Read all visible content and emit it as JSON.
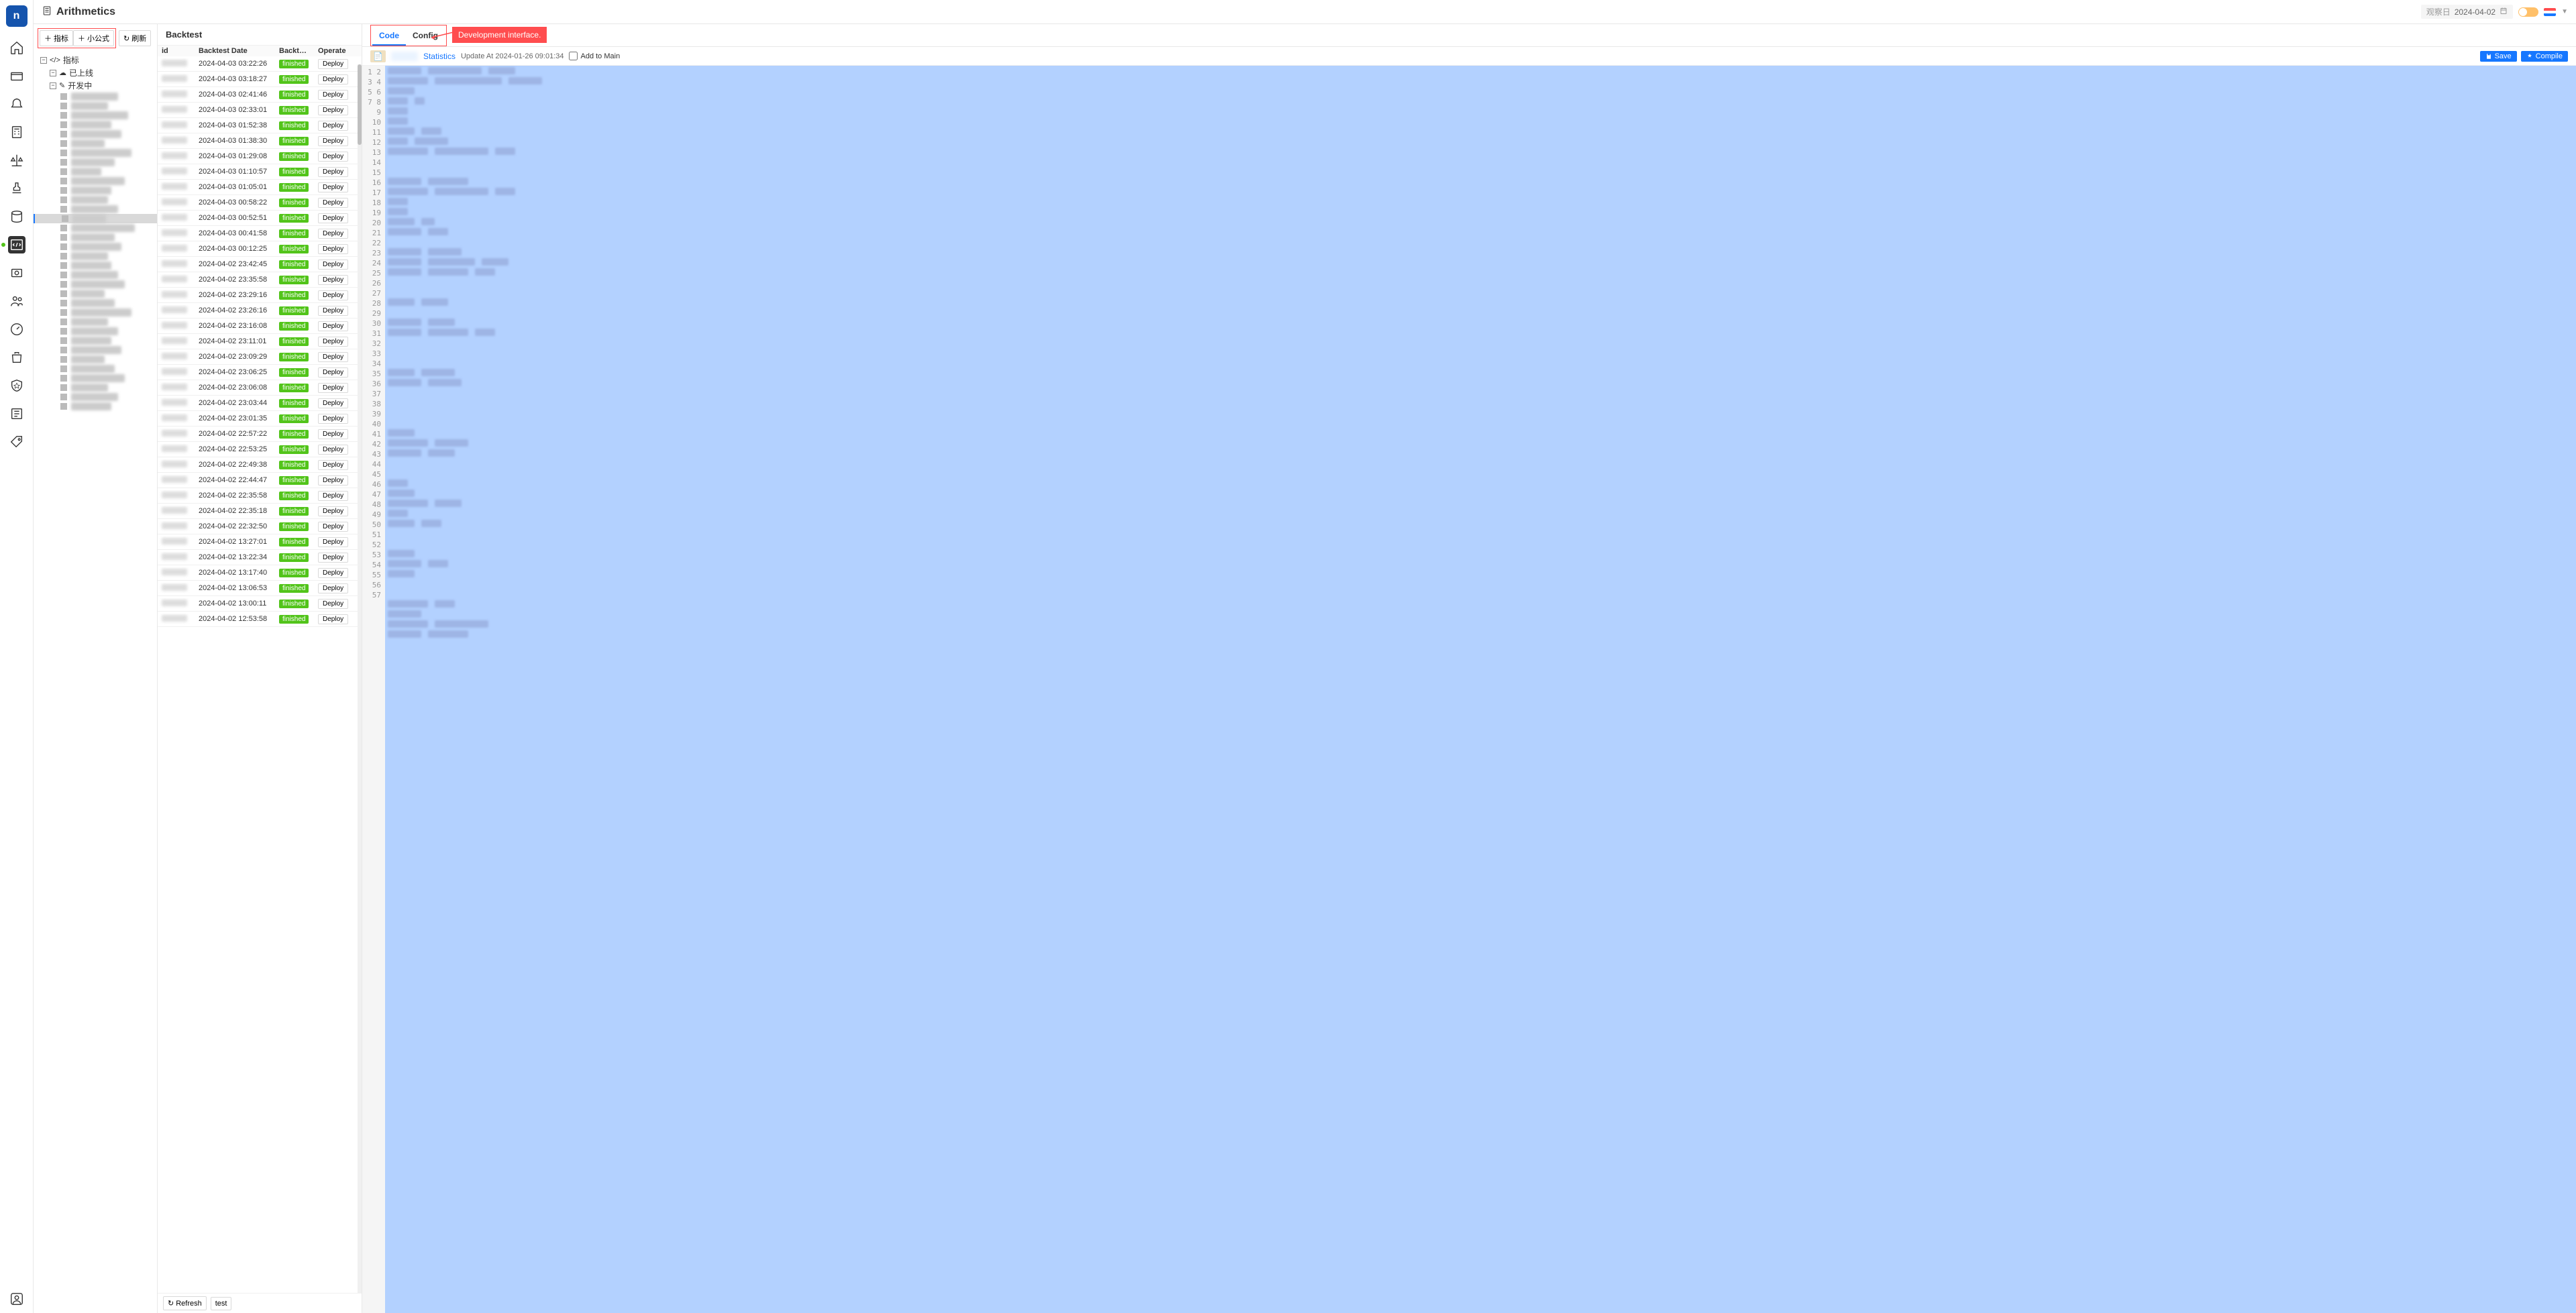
{
  "title": "Arithmetics",
  "header": {
    "obs_label": "观察日",
    "obs_date": "2024-04-02"
  },
  "toolbar": {
    "indicator": "指标",
    "formula": "小公式",
    "refresh": "刷新"
  },
  "tree": {
    "root": "指标",
    "online": "已上线",
    "developing": "开发中"
  },
  "backtest": {
    "title": "Backtest",
    "cols": {
      "id": "id",
      "date": "Backtest Date",
      "status": "Backtest ...",
      "operate": "Operate"
    },
    "status_label": "finished",
    "deploy_label": "Deploy",
    "refresh": "Refresh",
    "test": "test",
    "rows": [
      {
        "date": "2024-04-03 03:22:26"
      },
      {
        "date": "2024-04-03 03:18:27"
      },
      {
        "date": "2024-04-03 02:41:46"
      },
      {
        "date": "2024-04-03 02:33:01"
      },
      {
        "date": "2024-04-03 01:52:38"
      },
      {
        "date": "2024-04-03 01:38:30"
      },
      {
        "date": "2024-04-03 01:29:08"
      },
      {
        "date": "2024-04-03 01:10:57"
      },
      {
        "date": "2024-04-03 01:05:01"
      },
      {
        "date": "2024-04-03 00:58:22"
      },
      {
        "date": "2024-04-03 00:52:51"
      },
      {
        "date": "2024-04-03 00:41:58"
      },
      {
        "date": "2024-04-03 00:12:25"
      },
      {
        "date": "2024-04-02 23:42:45"
      },
      {
        "date": "2024-04-02 23:35:58"
      },
      {
        "date": "2024-04-02 23:29:16"
      },
      {
        "date": "2024-04-02 23:26:16"
      },
      {
        "date": "2024-04-02 23:16:08"
      },
      {
        "date": "2024-04-02 23:11:01"
      },
      {
        "date": "2024-04-02 23:09:29"
      },
      {
        "date": "2024-04-02 23:06:25"
      },
      {
        "date": "2024-04-02 23:06:08"
      },
      {
        "date": "2024-04-02 23:03:44"
      },
      {
        "date": "2024-04-02 23:01:35"
      },
      {
        "date": "2024-04-02 22:57:22"
      },
      {
        "date": "2024-04-02 22:53:25"
      },
      {
        "date": "2024-04-02 22:49:38"
      },
      {
        "date": "2024-04-02 22:44:47"
      },
      {
        "date": "2024-04-02 22:35:58"
      },
      {
        "date": "2024-04-02 22:35:18"
      },
      {
        "date": "2024-04-02 22:32:50"
      },
      {
        "date": "2024-04-02 13:27:01"
      },
      {
        "date": "2024-04-02 13:22:34"
      },
      {
        "date": "2024-04-02 13:17:40"
      },
      {
        "date": "2024-04-02 13:06:53"
      },
      {
        "date": "2024-04-02 13:00:11"
      },
      {
        "date": "2024-04-02 12:53:58"
      }
    ]
  },
  "code": {
    "tabs": {
      "code": "Code",
      "config": "Config"
    },
    "callout": "Development interface.",
    "statistics": "Statistics",
    "update": "Update At 2024-01-26 09:01:34",
    "add_main": "Add to Main",
    "save": "Save",
    "compile": "Compile",
    "line_numbers_start": 1,
    "line_numbers_end": 57
  }
}
